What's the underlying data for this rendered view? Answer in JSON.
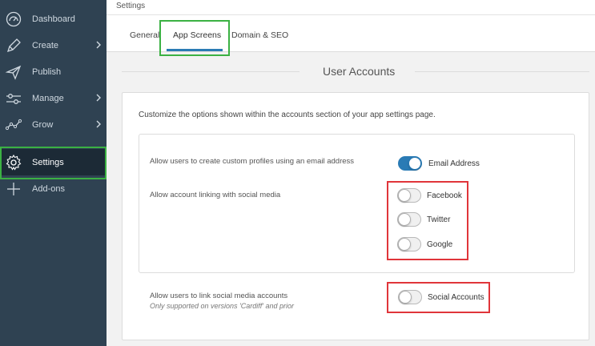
{
  "sidebar": {
    "items": [
      {
        "label": "Dashboard",
        "icon": "dashboard-icon"
      },
      {
        "label": "Create",
        "icon": "pencil-icon"
      },
      {
        "label": "Publish",
        "icon": "paper-plane-icon"
      },
      {
        "label": "Manage",
        "icon": "sliders-icon"
      },
      {
        "label": "Grow",
        "icon": "growth-chart-icon"
      },
      {
        "label": "Settings",
        "icon": "gear-icon"
      },
      {
        "label": "Add-ons",
        "icon": "plus-icon"
      }
    ]
  },
  "breadcrumb": "Settings",
  "tabs": [
    {
      "label": "General"
    },
    {
      "label": "App Screens"
    },
    {
      "label": "Domain & SEO"
    }
  ],
  "section": {
    "title": "User Accounts",
    "description": "Customize the options shown within the accounts section of your app settings page."
  },
  "options": {
    "email_label": "Allow users to create custom profiles using an email address",
    "email_toggle": {
      "label": "Email Address",
      "on": true
    },
    "linking_label": "Allow account linking with social media",
    "social_toggles": [
      {
        "label": "Facebook",
        "on": false
      },
      {
        "label": "Twitter",
        "on": false
      },
      {
        "label": "Google",
        "on": false
      }
    ],
    "link_social_label": "Allow users to link social media accounts",
    "link_social_note": "Only supported on versions 'Cardiff' and prior",
    "social_accounts_toggle": {
      "label": "Social Accounts",
      "on": false
    }
  },
  "colors": {
    "sidebar_bg": "#2f4252",
    "accent_blue": "#2a7bb5",
    "highlight_green": "#3bb143",
    "highlight_red": "#e0353a"
  }
}
